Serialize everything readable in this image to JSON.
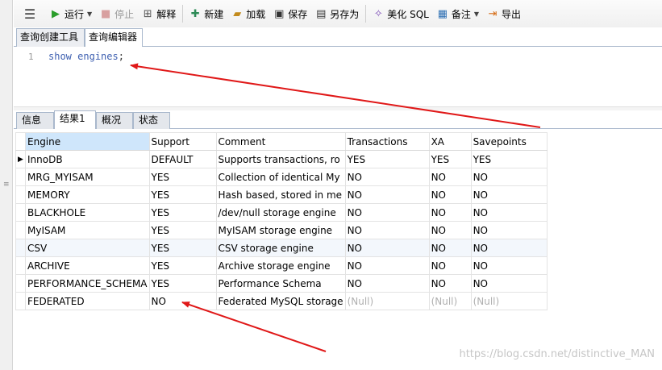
{
  "toolbar": {
    "run_label": "运行",
    "stop_label": "停止",
    "explain_label": "解释",
    "new_label": "新建",
    "load_label": "加载",
    "save_label": "保存",
    "save_as_label": "另存为",
    "beautify_label": "美化 SQL",
    "notes_label": "备注",
    "export_label": "导出"
  },
  "top_tabs": [
    {
      "label": "查询创建工具"
    },
    {
      "label": "查询编辑器",
      "active": true
    }
  ],
  "editor": {
    "line_number": "1",
    "keyword1": "show",
    "keyword2": "engines",
    "terminator": ";"
  },
  "result_tabs": [
    {
      "label": "信息"
    },
    {
      "label": "结果1",
      "active": true
    },
    {
      "label": "概况"
    },
    {
      "label": "状态"
    }
  ],
  "grid": {
    "columns": [
      "Engine",
      "Support",
      "Comment",
      "Transactions",
      "XA",
      "Savepoints"
    ],
    "rows": [
      [
        "InnoDB",
        "DEFAULT",
        "Supports transactions, ro",
        "YES",
        "YES",
        "YES"
      ],
      [
        "MRG_MYISAM",
        "YES",
        "Collection of identical My",
        "NO",
        "NO",
        "NO"
      ],
      [
        "MEMORY",
        "YES",
        "Hash based, stored in me",
        "NO",
        "NO",
        "NO"
      ],
      [
        "BLACKHOLE",
        "YES",
        "/dev/null storage engine",
        "NO",
        "NO",
        "NO"
      ],
      [
        "MyISAM",
        "YES",
        "MyISAM storage engine",
        "NO",
        "NO",
        "NO"
      ],
      [
        "CSV",
        "YES",
        "CSV storage engine",
        "NO",
        "NO",
        "NO"
      ],
      [
        "ARCHIVE",
        "YES",
        "Archive storage engine",
        "NO",
        "NO",
        "NO"
      ],
      [
        "PERFORMANCE_SCHEMA",
        "YES",
        "Performance Schema",
        "NO",
        "NO",
        "NO"
      ],
      [
        "FEDERATED",
        "NO",
        "Federated MySQL storage",
        "(Null)",
        "(Null)",
        "(Null)"
      ]
    ]
  },
  "watermark": "https://blog.csdn.net/distinctive_MAN",
  "colors": {
    "arrow": "#e01818",
    "sorted_header": "#cfe6fb",
    "null_text": "#b0b0b0",
    "keyword": "#3d5fb0"
  }
}
